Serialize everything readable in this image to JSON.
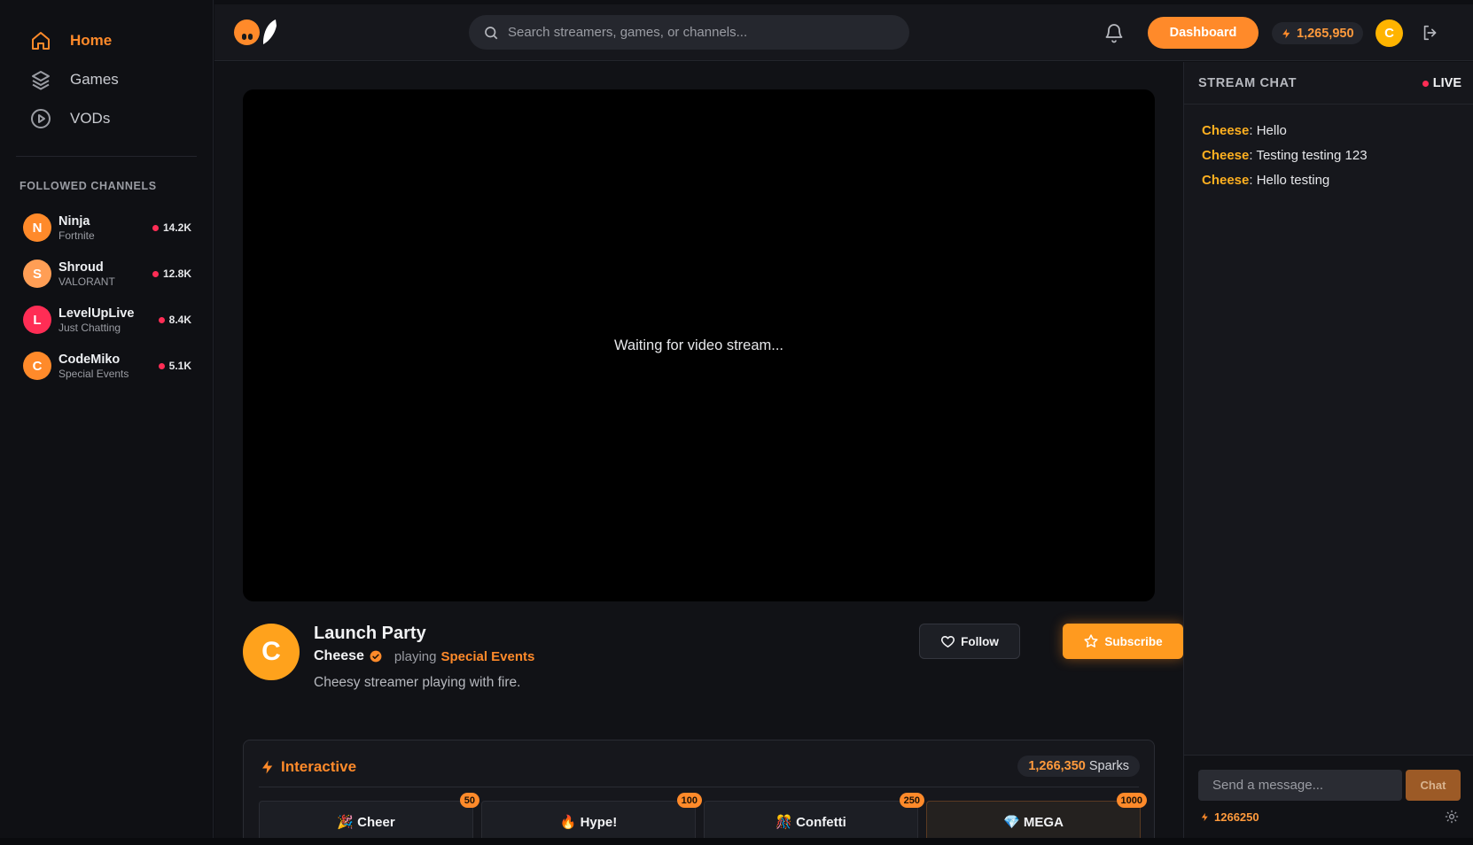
{
  "sidebar": {
    "nav": [
      {
        "label": "Home",
        "icon": "home-icon",
        "active": true
      },
      {
        "label": "Games",
        "icon": "layers-icon"
      },
      {
        "label": "VODs",
        "icon": "play-circle-icon"
      }
    ],
    "followed_title": "FOLLOWED CHANNELS",
    "channels": [
      {
        "initial": "N",
        "name": "Ninja",
        "game": "Fortnite",
        "viewers": "14.2K",
        "color": "#ff8a2a"
      },
      {
        "initial": "S",
        "name": "Shroud",
        "game": "VALORANT",
        "viewers": "12.8K",
        "color": "#ff9e55"
      },
      {
        "initial": "L",
        "name": "LevelUpLive",
        "game": "Just Chatting",
        "viewers": "8.4K",
        "color": "#ff2d55"
      },
      {
        "initial": "C",
        "name": "CodeMiko",
        "game": "Special Events",
        "viewers": "5.1K",
        "color": "#ff8a2a"
      }
    ]
  },
  "topbar": {
    "search_placeholder": "Search streamers, games, or channels...",
    "dashboard_label": "Dashboard",
    "balance": "1,265,950",
    "user_initial": "C"
  },
  "player": {
    "status": "Waiting for video stream..."
  },
  "stream": {
    "avatar_initial": "C",
    "title": "Launch Party",
    "streamer": "Cheese",
    "playing_label": "playing",
    "game": "Special Events",
    "description": "Cheesy streamer playing with fire.",
    "follow_label": "Follow",
    "subscribe_label": "Subscribe"
  },
  "interactive": {
    "title": "Interactive",
    "sparks_value": "1,266,350",
    "sparks_label": "Sparks",
    "effects": [
      {
        "label": "🎉 Cheer",
        "cost": "50"
      },
      {
        "label": "🔥 Hype!",
        "cost": "100"
      },
      {
        "label": "🎊 Confetti",
        "cost": "250"
      },
      {
        "label": "💎 MEGA",
        "cost": "1000"
      }
    ]
  },
  "chat": {
    "title": "STREAM CHAT",
    "live_label": "LIVE",
    "messages": [
      {
        "user": "Cheese",
        "text": "Hello"
      },
      {
        "user": "Cheese",
        "text": "Testing testing 123"
      },
      {
        "user": "Cheese",
        "text": "Hello testing"
      }
    ],
    "input_placeholder": "Send a message...",
    "send_label": "Chat",
    "balance": "1266250"
  },
  "colors": {
    "accent": "#ff8a2a",
    "live": "#ff2d55",
    "chat_user": "#ffb020"
  }
}
